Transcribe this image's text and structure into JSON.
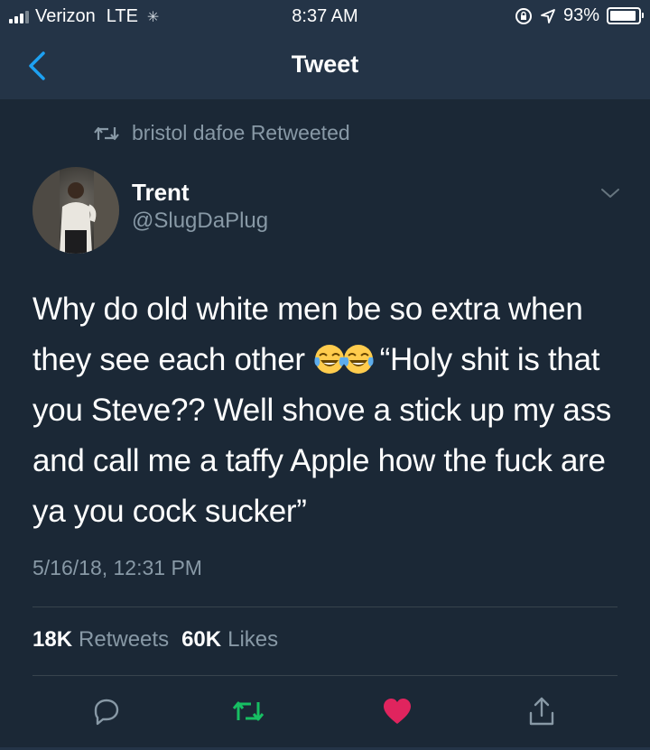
{
  "status_bar": {
    "carrier": "Verizon",
    "network": "LTE",
    "activity_icon": "spinner-icon",
    "time": "8:37 AM",
    "battery_percent": "93%",
    "battery_level": 0.93
  },
  "header": {
    "title": "Tweet",
    "back_icon": "chevron-left-icon"
  },
  "retweet_context": {
    "icon": "retweet-icon",
    "text": "bristol dafoe Retweeted"
  },
  "tweet": {
    "author_name": "Trent",
    "author_handle": "@SlugDaPlug",
    "text_before_emoji": "Why do old white men be so extra when they see each other",
    "emoji": "face-with-tears-of-joy",
    "text_after_emoji": " “Holy shit is that you Steve?? Well shove a stick up my ass and call me a taffy Apple how the fuck are ya you cock sucker”",
    "timestamp": "5/16/18, 12:31 PM",
    "retweets_count": "18K",
    "retweets_label": "Retweets",
    "likes_count": "60K",
    "likes_label": "Likes"
  },
  "actions": [
    {
      "name": "reply",
      "icon": "reply-icon"
    },
    {
      "name": "retweet",
      "icon": "retweet-icon",
      "color": "#17bf63"
    },
    {
      "name": "like",
      "icon": "heart-icon",
      "color": "#e0245e"
    },
    {
      "name": "share",
      "icon": "share-icon"
    }
  ],
  "colors": {
    "background": "#1b2836",
    "header": "#243447",
    "secondary_text": "#8899a6",
    "accent": "#1da1f2"
  }
}
